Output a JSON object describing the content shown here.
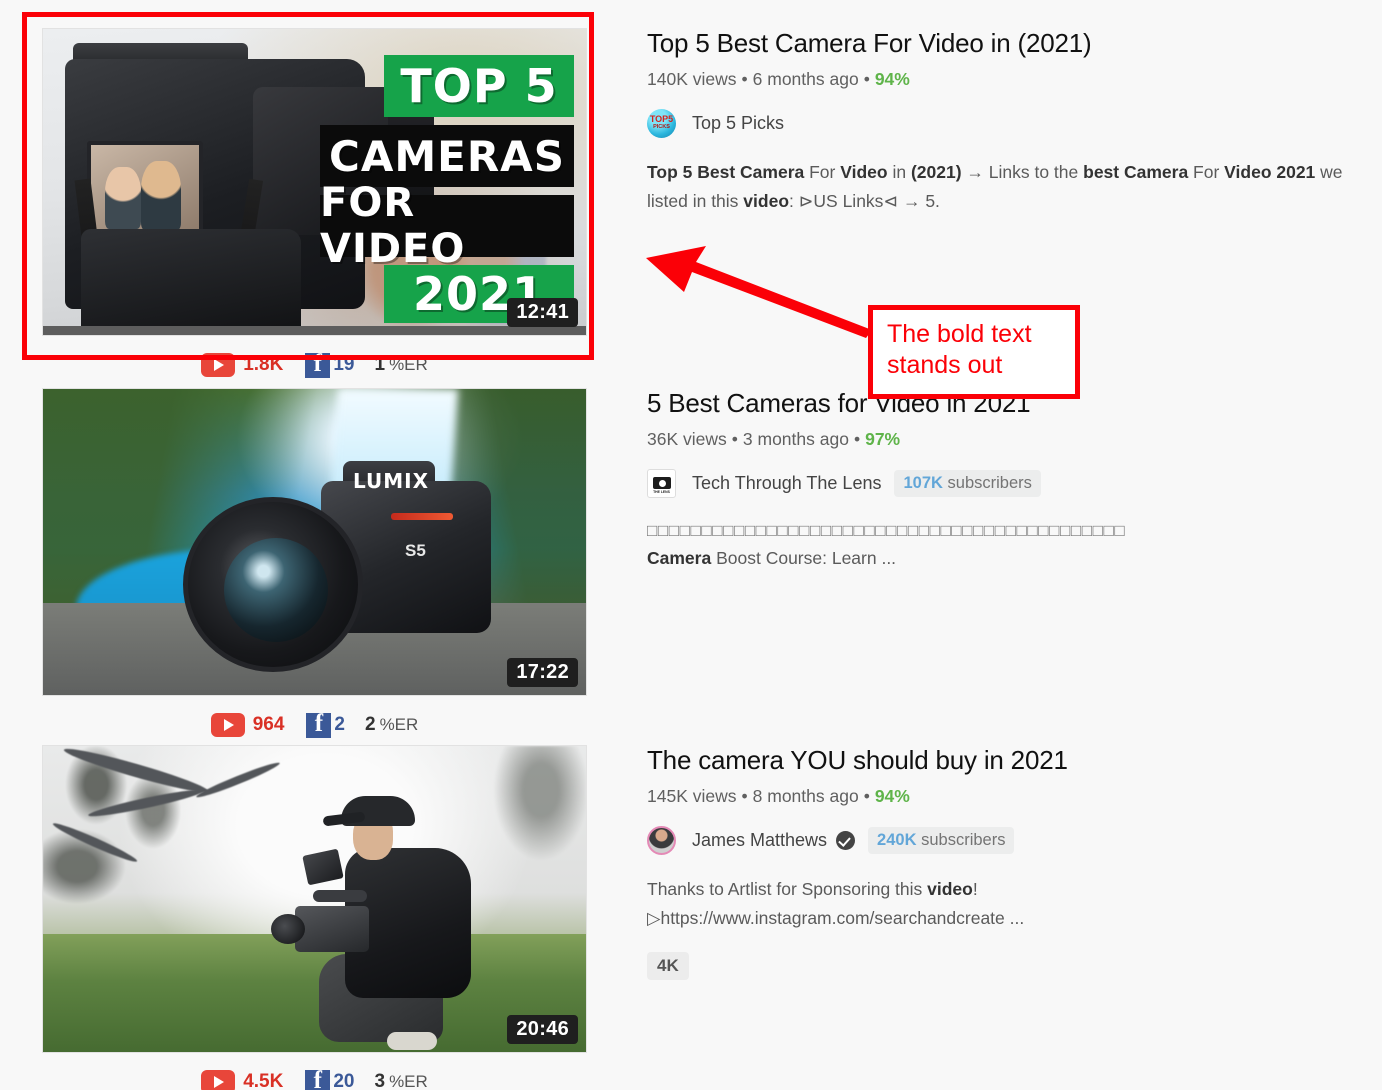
{
  "page": {
    "background": "#f8f8f8"
  },
  "annotation": {
    "highlight_color": "#fb0007",
    "note_text_line1": "The bold text",
    "note_text_line2": "stands out"
  },
  "stats_labels": {
    "er_suffix": "%ER"
  },
  "videos": [
    {
      "title": "Top 5 Best Camera For Video in (2021)",
      "views": "140K views",
      "age": "6 months ago",
      "percent": "94%",
      "duration": "12:41",
      "channel": {
        "name": "Top 5 Picks",
        "avatar_icon": "top5-picks-avatar",
        "verified": false,
        "subscribers": null
      },
      "description_parts": [
        {
          "text": "Top 5",
          "bold": true
        },
        {
          "text": " ",
          "bold": false
        },
        {
          "text": "Best Camera",
          "bold": true
        },
        {
          "text": " For ",
          "bold": false
        },
        {
          "text": "Video",
          "bold": true
        },
        {
          "text": " in ",
          "bold": false
        },
        {
          "text": "(2021)",
          "bold": true
        },
        {
          "text": " → Links to the ",
          "bold": false
        },
        {
          "text": "best Camera",
          "bold": true
        },
        {
          "text": " For ",
          "bold": false
        },
        {
          "text": "Video 2021",
          "bold": true
        },
        {
          "text": " we listed in this ",
          "bold": false
        },
        {
          "text": "video",
          "bold": true
        },
        {
          "text": ": ⊳US Links⊲ → 5.",
          "bold": false
        }
      ],
      "stats": {
        "youtube": "1.8K",
        "facebook": "19",
        "er": "1"
      },
      "badge": null,
      "tofu_line": null,
      "highlighted": true
    },
    {
      "title": "5 Best Cameras for Video in 2021",
      "views": "36K views",
      "age": "3 months ago",
      "percent": "97%",
      "duration": "17:22",
      "channel": {
        "name": "Tech Through The Lens",
        "avatar_icon": "tech-through-the-lens-avatar",
        "verified": false,
        "subscribers_count": "107K",
        "subscribers_label": "subscribers"
      },
      "tofu_line": "□□□□□□□□□□□□□□□□□□□□□□□□□□□□□□□□□□□□□□□□□□□□",
      "description_parts": [
        {
          "text": "Camera",
          "bold": true
        },
        {
          "text": " Boost Course: Learn ...",
          "bold": false
        }
      ],
      "stats": {
        "youtube": "964",
        "facebook": "2",
        "er": "2"
      },
      "badge": null,
      "highlighted": false
    },
    {
      "title": "The camera YOU should buy in 2021",
      "views": "145K views",
      "age": "8 months ago",
      "percent": "94%",
      "duration": "20:46",
      "channel": {
        "name": "James Matthews",
        "avatar_icon": "james-matthews-avatar",
        "verified": true,
        "subscribers_count": "240K",
        "subscribers_label": "subscribers"
      },
      "description_parts": [
        {
          "text": "Thanks to Artlist for Sponsoring this ",
          "bold": false
        },
        {
          "text": "video",
          "bold": true
        },
        {
          "text": "!",
          "bold": false
        }
      ],
      "description_line2_parts": [
        {
          "text": "▷https://www.instagram.com/searchandcreate ...",
          "bold": false
        }
      ],
      "stats": {
        "youtube": "4.5K",
        "facebook": "20",
        "er": "3"
      },
      "badge": "4K",
      "tofu_line": null,
      "highlighted": false
    }
  ],
  "thumbnail_text": {
    "video1": {
      "line1": "TOP 5",
      "line2": "CAMERAS",
      "line3": "FOR VIDEO",
      "line4": "2021"
    },
    "video2": {
      "brand": "LUMIX",
      "model": "S5"
    }
  }
}
